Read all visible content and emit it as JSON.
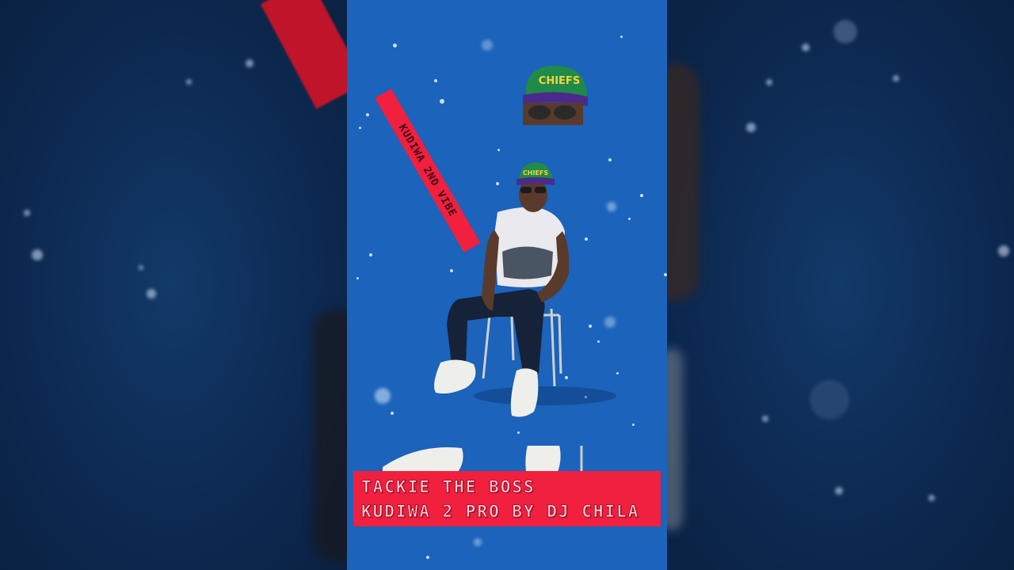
{
  "video": {
    "banner_text": "KUDIWA 2ND VIBE",
    "title_line1": "TACKIE THE BOSS",
    "title_line2": "KUDIWA 2 PRO BY DJ CHILA",
    "cap_text": "CHIEFS"
  },
  "colors": {
    "panel_background": "#1b63bb",
    "side_background": "#0d2a52",
    "banner_red": "#f0203e",
    "cap_green": "#1f8a4a"
  }
}
